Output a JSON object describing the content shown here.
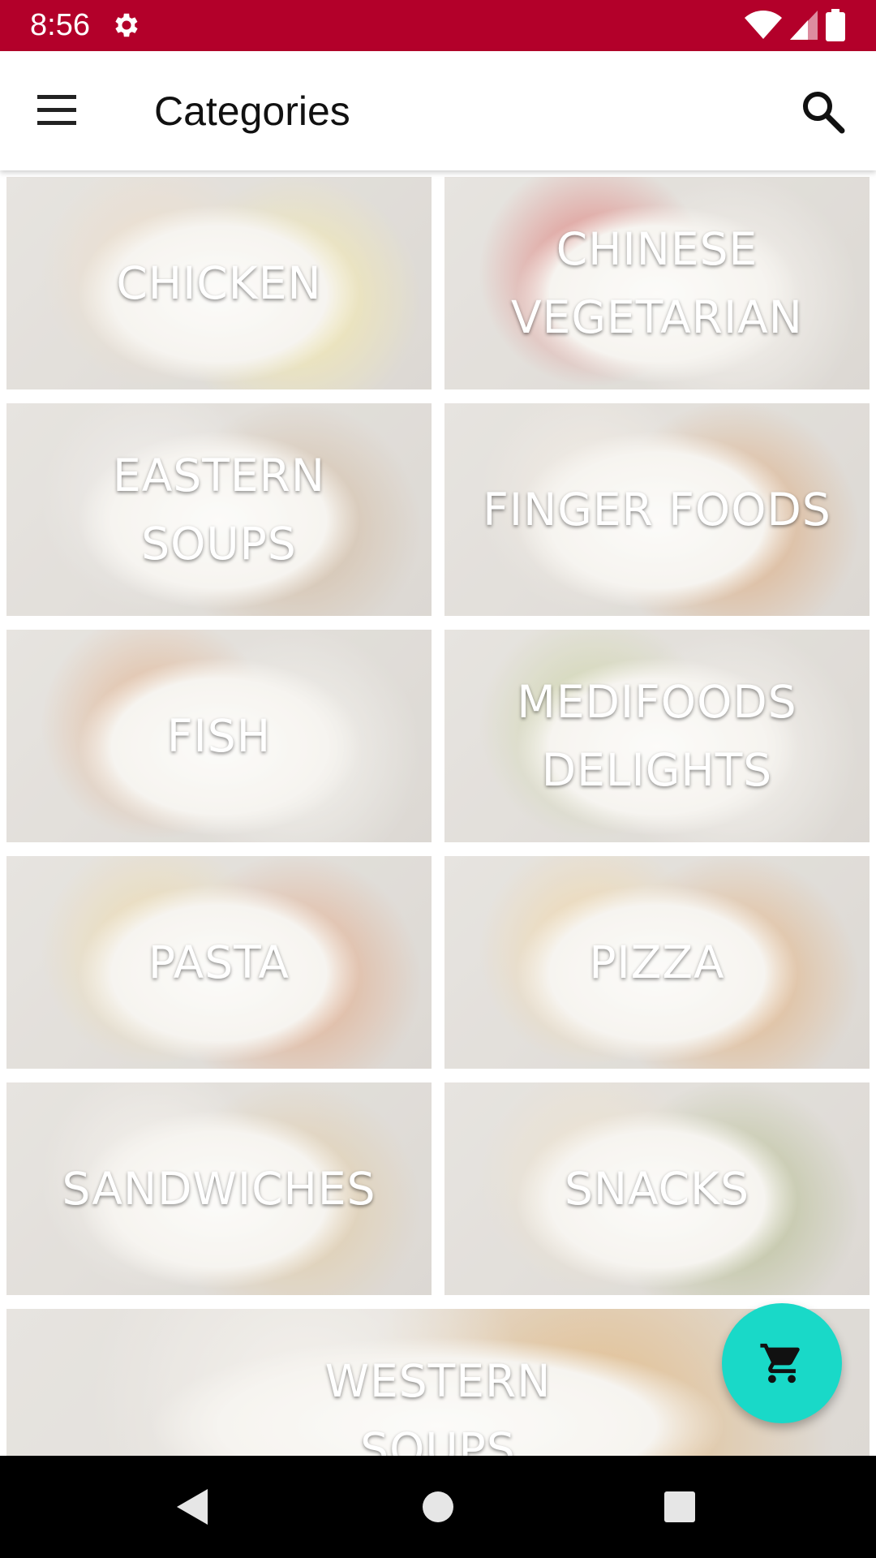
{
  "status_bar": {
    "time": "8:56",
    "background_color": "#b3002a",
    "icons": [
      "gear-icon",
      "wifi-icon",
      "signal-icon",
      "battery-icon"
    ]
  },
  "app_bar": {
    "title": "Categories",
    "menu_icon": "hamburger-menu-icon",
    "search_icon": "search-icon"
  },
  "categories": [
    {
      "label": "CHICKEN",
      "colors": [
        "#e9d4b8",
        "#f2e38a"
      ]
    },
    {
      "label": "CHINESE VEGETARIAN",
      "colors": [
        "#d2504a",
        "#f4f0ea"
      ]
    },
    {
      "label": "EASTERN SOUPS",
      "colors": [
        "#ece9e6",
        "#c3a27f"
      ]
    },
    {
      "label": "FINGER FOODS",
      "colors": [
        "#efe7dd",
        "#d08b4e"
      ]
    },
    {
      "label": "FISH",
      "colors": [
        "#d89a6b",
        "#f1efe9"
      ]
    },
    {
      "label": "MEDIFOODS DELIGHTS",
      "colors": [
        "#bcc58a",
        "#f2efe9"
      ]
    },
    {
      "label": "PASTA",
      "colors": [
        "#e9cf90",
        "#d98a5b"
      ]
    },
    {
      "label": "PIZZA",
      "colors": [
        "#edc98a",
        "#d99552"
      ]
    },
    {
      "label": "SANDWICHES",
      "colors": [
        "#f2eee8",
        "#d8b985"
      ]
    },
    {
      "label": "SNACKS",
      "colors": [
        "#e9d9bd",
        "#9aa467"
      ]
    },
    {
      "label": "WESTERN SOUPS",
      "colors": [
        "#f1ede7",
        "#d9a25a"
      ]
    }
  ],
  "fab": {
    "icon": "shopping-cart-icon",
    "color": "#19d9c8"
  },
  "nav_bar": {
    "icons": [
      "back-triangle-icon",
      "home-circle-icon",
      "recents-square-icon"
    ]
  }
}
